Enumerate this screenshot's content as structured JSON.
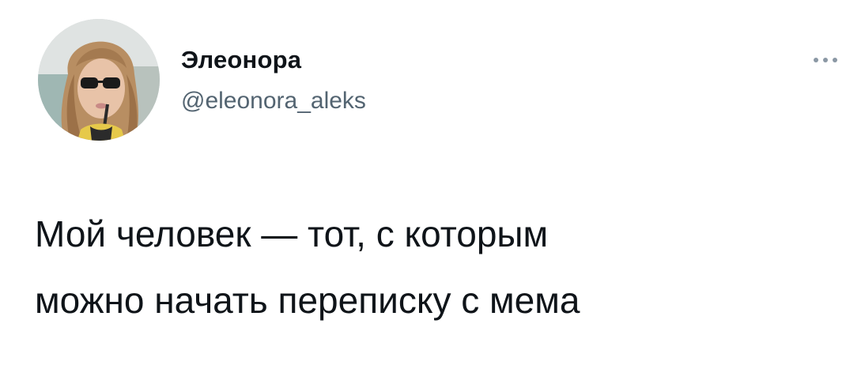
{
  "tweet": {
    "author": {
      "display_name": "Элеонора",
      "handle": "@eleonora_aleks",
      "avatar_icon": "profile-photo-avatar"
    },
    "menu_icon": "more-horizontal-icon",
    "text": "Мой человек — тот, с которым\nможно начать переписку с мема"
  },
  "colors": {
    "background": "#ffffff",
    "primary_text": "#0f1419",
    "secondary_text": "#536471",
    "icon": "#8b98a5"
  }
}
